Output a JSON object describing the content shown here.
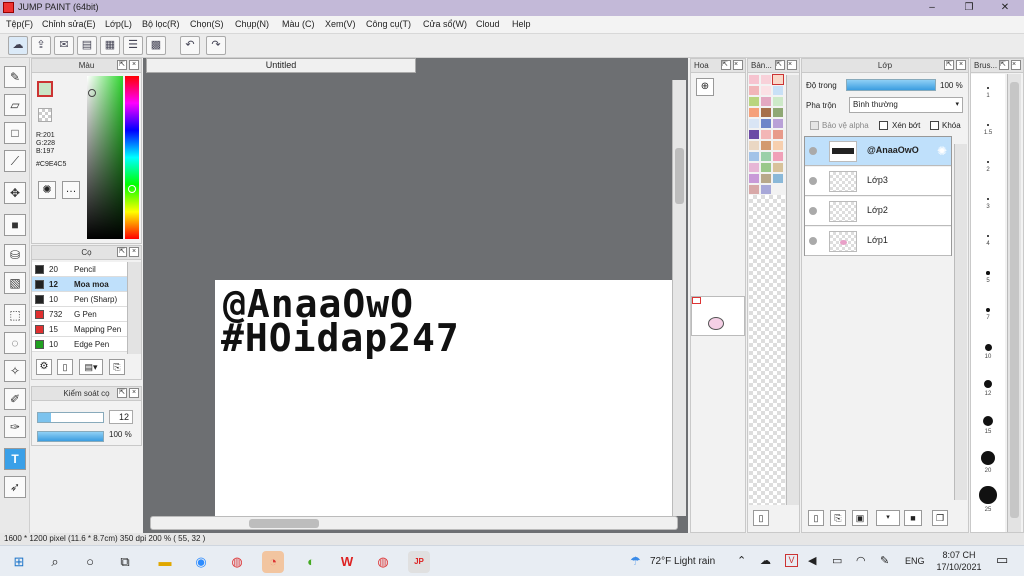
{
  "window": {
    "title": "JUMP PAINT (64bit)"
  },
  "menu": [
    "Tệp(F)",
    "Chỉnh sửa(E)",
    "Lớp(L)",
    "Bộ lọc(R)",
    "Chọn(S)",
    "Chụp(N)",
    "Màu (C)",
    "Xem(V)",
    "Công cụ(T)",
    "Cửa sổ(W)",
    "Cloud",
    "Help"
  ],
  "document": {
    "tab_title": "Untitled",
    "line1": "@AnaaOwO",
    "line2": "#HOidap247"
  },
  "color_panel": {
    "title": "Màu",
    "r": "R:201",
    "g": "G:228",
    "b": "B:197",
    "hex": "#C9E4C5"
  },
  "brush_panel": {
    "title": "Cọ",
    "items": [
      {
        "size": "20",
        "name": "Pencil",
        "color": "#222222"
      },
      {
        "size": "12",
        "name": "Moa moa",
        "color": "#222222"
      },
      {
        "size": "10",
        "name": "Pen (Sharp)",
        "color": "#222222"
      },
      {
        "size": "732",
        "name": "G Pen",
        "color": "#e03030"
      },
      {
        "size": "15",
        "name": "Mapping Pen",
        "color": "#e03030"
      },
      {
        "size": "10",
        "name": "Edge Pen",
        "color": "#20a020"
      }
    ]
  },
  "brush_control": {
    "title": "Kiểm soát cọ",
    "size": "12",
    "opacity": "100 %"
  },
  "nav_panel": {
    "title": "Hoa"
  },
  "palette_panel": {
    "title": "Bản..."
  },
  "layer_panel": {
    "title": "Lớp",
    "opacity_label": "Độ trong",
    "opacity_value": "100 %",
    "blend_label": "Pha trộn",
    "blend_value": "Bình thường",
    "protect_alpha": "Bảo vệ alpha",
    "clipping": "Xén bớt",
    "lock": "Khóa",
    "layers": [
      "@AnaaOwO",
      "Lớp3",
      "Lớp2",
      "Lớp1"
    ]
  },
  "brush_sizes": {
    "title": "Brus...",
    "labels": [
      "1",
      "1.5",
      "2",
      "3",
      "4",
      "5",
      "7",
      "10",
      "12",
      "15",
      "20",
      "25"
    ]
  },
  "status": {
    "text": "1600 * 1200 pixel   (11.6 * 8.7cm)   350 dpi   200 %   ( 55, 32 )"
  },
  "taskbar": {
    "weather": "72°F  Light rain",
    "lang": "ENG",
    "time": "8:07 CH",
    "date": "17/10/2021"
  }
}
